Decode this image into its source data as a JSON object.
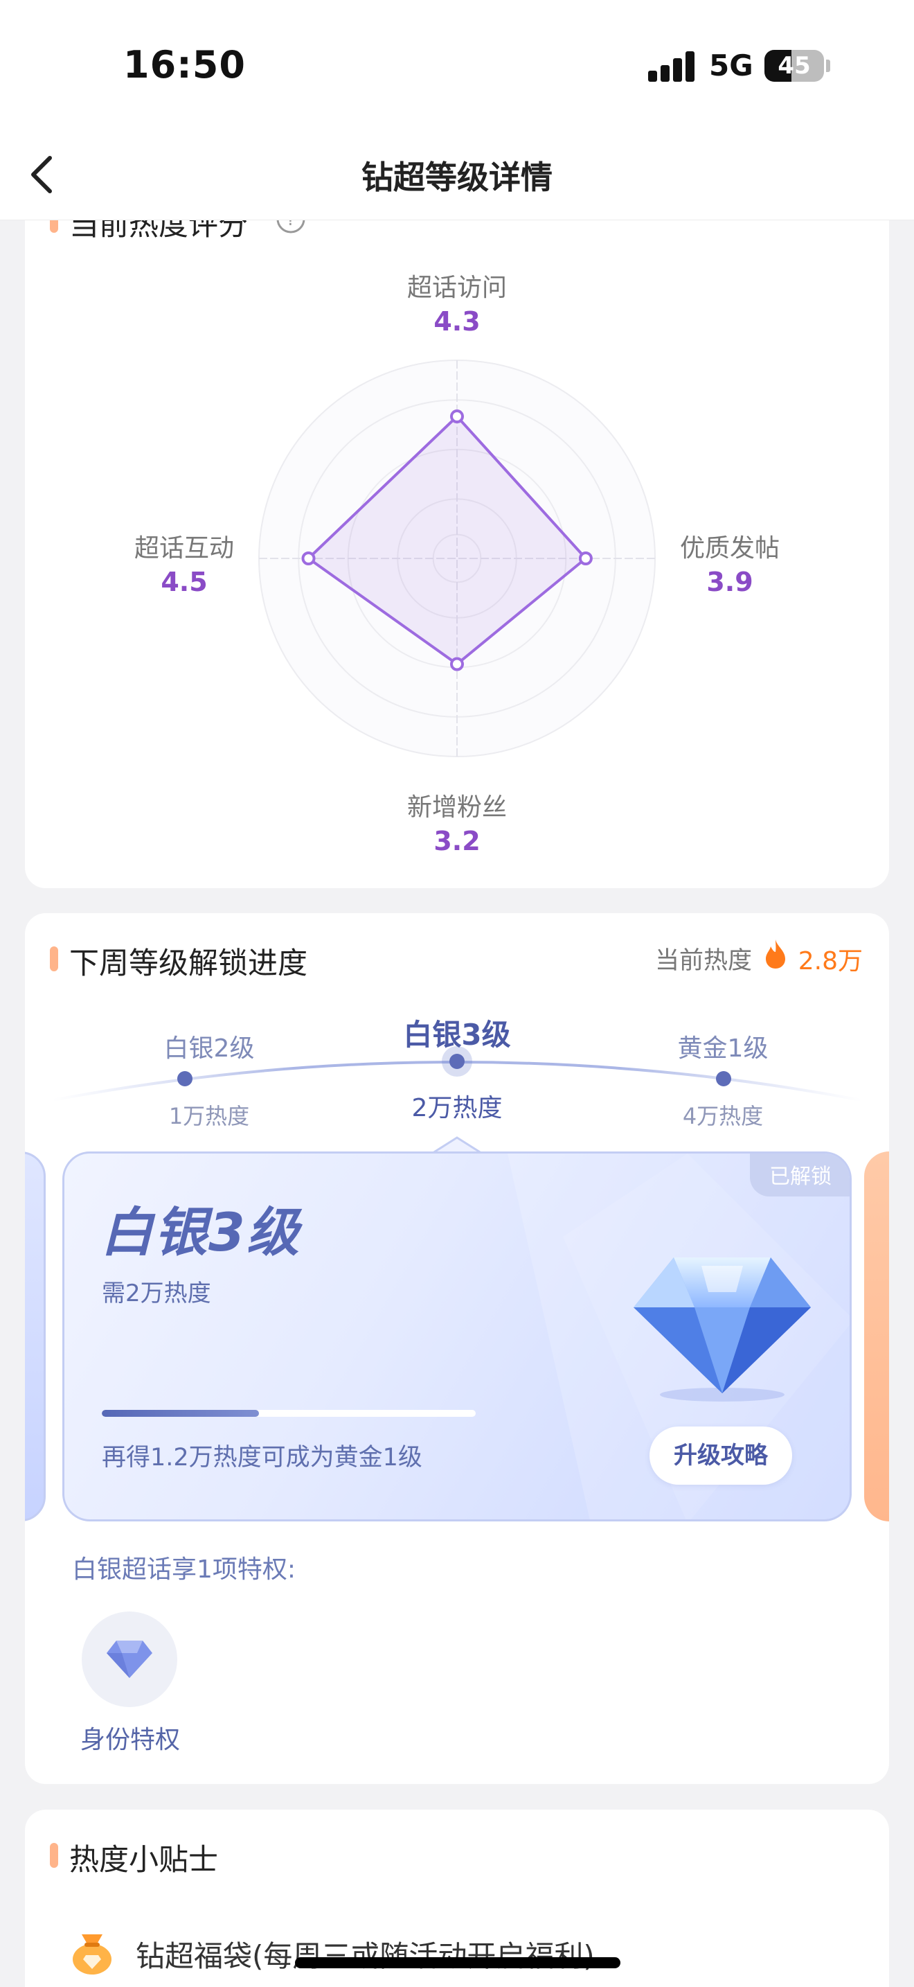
{
  "status_bar": {
    "time": "16:50",
    "network": "5G",
    "battery": "45",
    "battery_level": 0.45
  },
  "nav": {
    "title": "钻超等级详情",
    "back_icon": "chevron-left-icon"
  },
  "radar": {
    "title": "当前热度评分",
    "accent": "#9d6be0",
    "max": 6,
    "axes": [
      {
        "label": "超话访问",
        "value": "4.3"
      },
      {
        "label": "优质发帖",
        "value": "3.9"
      },
      {
        "label": "新增粉丝",
        "value": "3.2"
      },
      {
        "label": "超话互动",
        "value": "4.5"
      }
    ]
  },
  "level": {
    "title": "下周等级解锁进度",
    "current_heat_label": "当前热度",
    "current_heat_value": "2.8万",
    "heat_color": "#ff7a1a",
    "steps": [
      {
        "name": "白银2级",
        "heat": "1万热度",
        "active": false
      },
      {
        "name": "白银3级",
        "heat": "2万热度",
        "active": true
      },
      {
        "name": "黄金1级",
        "heat": "4万热度",
        "active": false
      }
    ],
    "card": {
      "badge": "已解锁",
      "title": "白银3级",
      "subtitle": "需2万热度",
      "progress": 0.42,
      "tip": "再得1.2万热度可成为黄金1级",
      "button": "升级攻略",
      "gem_icon": "diamond-icon"
    },
    "privilege_title": "白银超话享1项特权:",
    "privileges": [
      {
        "label": "身份特权",
        "icon": "gem-badge-icon"
      }
    ]
  },
  "tips": {
    "title": "热度小贴士",
    "items": [
      {
        "text": "钻超福袋(每周三或随活动开启福利)",
        "icon": "lucky-bag-icon"
      }
    ]
  }
}
